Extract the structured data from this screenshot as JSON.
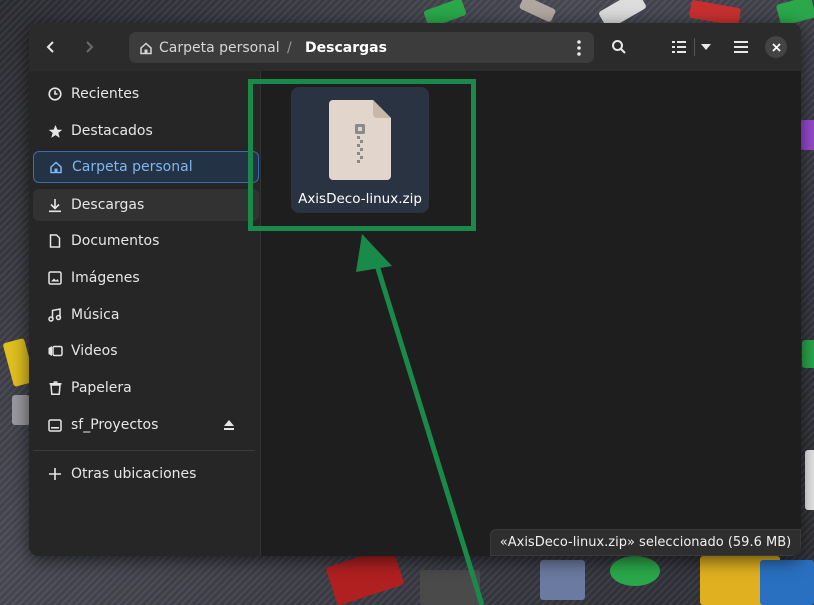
{
  "headerbar": {
    "back_icon": "chevron-left-icon",
    "forward_icon": "chevron-right-icon",
    "path": {
      "home_label": "Carpeta personal",
      "separator": "/",
      "current": "Descargas"
    },
    "search_icon": "search-icon",
    "view_icon": "list-view-icon",
    "menu_icon": "hamburger-menu-icon",
    "close_icon": "close-icon"
  },
  "sidebar": {
    "items": [
      {
        "label": "Recientes",
        "icon": "clock-icon"
      },
      {
        "label": "Destacados",
        "icon": "star-icon"
      },
      {
        "label": "Carpeta personal",
        "icon": "home-icon"
      },
      {
        "label": "Descargas",
        "icon": "download-icon"
      },
      {
        "label": "Documentos",
        "icon": "document-icon"
      },
      {
        "label": "Imágenes",
        "icon": "image-icon"
      },
      {
        "label": "Música",
        "icon": "music-icon"
      },
      {
        "label": "Videos",
        "icon": "video-icon"
      },
      {
        "label": "Papelera",
        "icon": "trash-icon"
      },
      {
        "label": "sf_Proyectos",
        "icon": "drive-icon"
      }
    ],
    "other_locations": "Otras ubicaciones"
  },
  "files": [
    {
      "name": "AxisDeco-linux.zip",
      "icon": "zip-archive-icon"
    }
  ],
  "status": {
    "text": "«AxisDeco-linux.zip» seleccionado  (59.6 MB)"
  },
  "colors": {
    "accent": "#7eb6f2",
    "annotation": "#1a8a4a",
    "selection": "#2a3342"
  }
}
